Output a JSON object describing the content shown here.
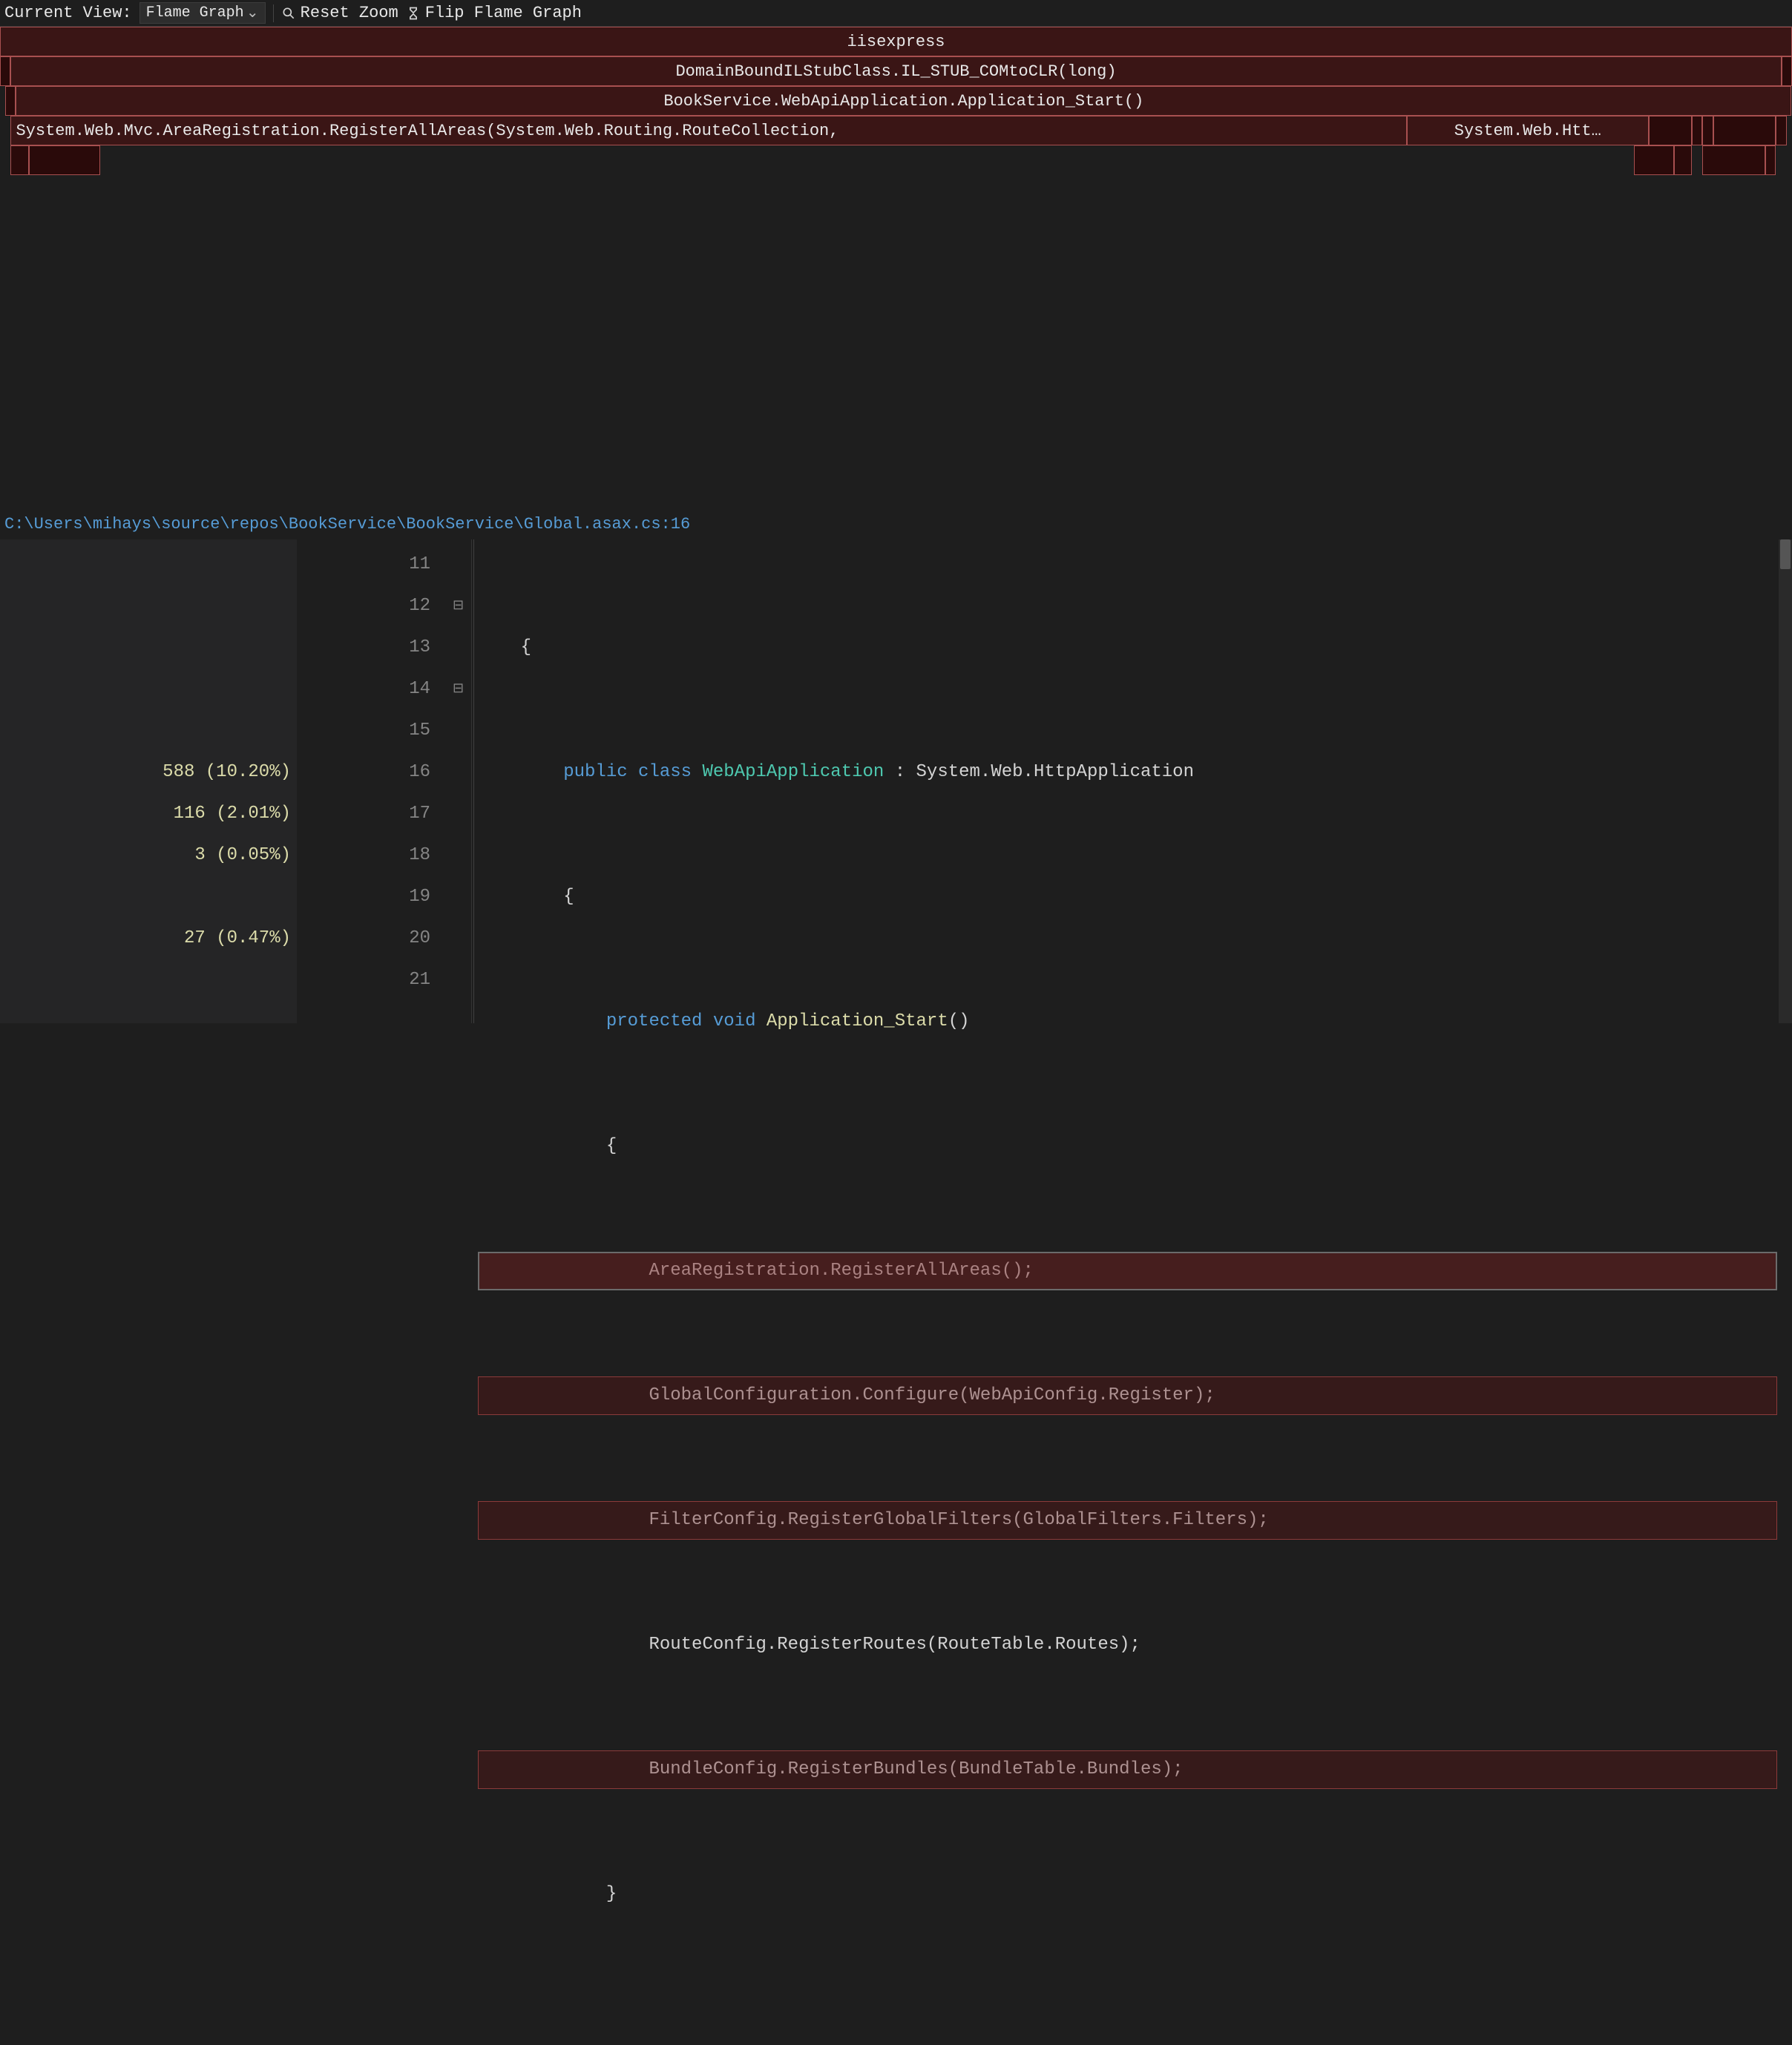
{
  "toolbar": {
    "current_view_label": "Current View:",
    "view_value": "Flame Graph",
    "reset_zoom_label": "Reset Zoom",
    "flip_label": "Flip Flame Graph"
  },
  "flame": {
    "row0": {
      "root_label": "iisexpress"
    },
    "row1": {
      "a_label": "DomainBoundILStubClass.IL_STUB_COMtoCLR(long)"
    },
    "row2": {
      "a_label": "BookService.WebApiApplication.Application_Start()"
    },
    "row3": {
      "a_label": "System.Web.Mvc.AreaRegistration.RegisterAllAreas(System.Web.Routing.RouteCollection,",
      "b_label": "System.Web.Htt…"
    }
  },
  "file_path": "C:\\Users\\mihays\\source\\repos\\BookService\\BookService\\Global.asax.cs:16",
  "samples": {
    "l16": "588 (10.20%)",
    "l17": "116 (2.01%)",
    "l18": "3 (0.05%)",
    "l20": "27 (0.47%)"
  },
  "lines": {
    "n11": "11",
    "n12": "12",
    "n13": "13",
    "n14": "14",
    "n15": "15",
    "n16": "16",
    "n17": "17",
    "n18": "18",
    "n19": "19",
    "n20": "20",
    "n21": "21"
  },
  "fold": {
    "minus": "⊟"
  },
  "code": {
    "l11_brace": "{",
    "l12_public": "public",
    "l12_class": "class",
    "l12_name": "WebApiApplication",
    "l12_rest": " : System.Web.HttpApplication",
    "l13_brace": "{",
    "l14_protected": "protected",
    "l14_void": "void",
    "l14_name": "Application_Start",
    "l14_paren": "()",
    "l15_brace": "{",
    "l16": "AreaRegistration.RegisterAllAreas();",
    "l17": "GlobalConfiguration.Configure(WebApiConfig.Register);",
    "l18": "FilterConfig.RegisterGlobalFilters(GlobalFilters.Filters);",
    "l19": "RouteConfig.RegisterRoutes(RouteTable.Routes);",
    "l20": "BundleConfig.RegisterBundles(BundleTable.Bundles);",
    "l21_brace": "}"
  }
}
